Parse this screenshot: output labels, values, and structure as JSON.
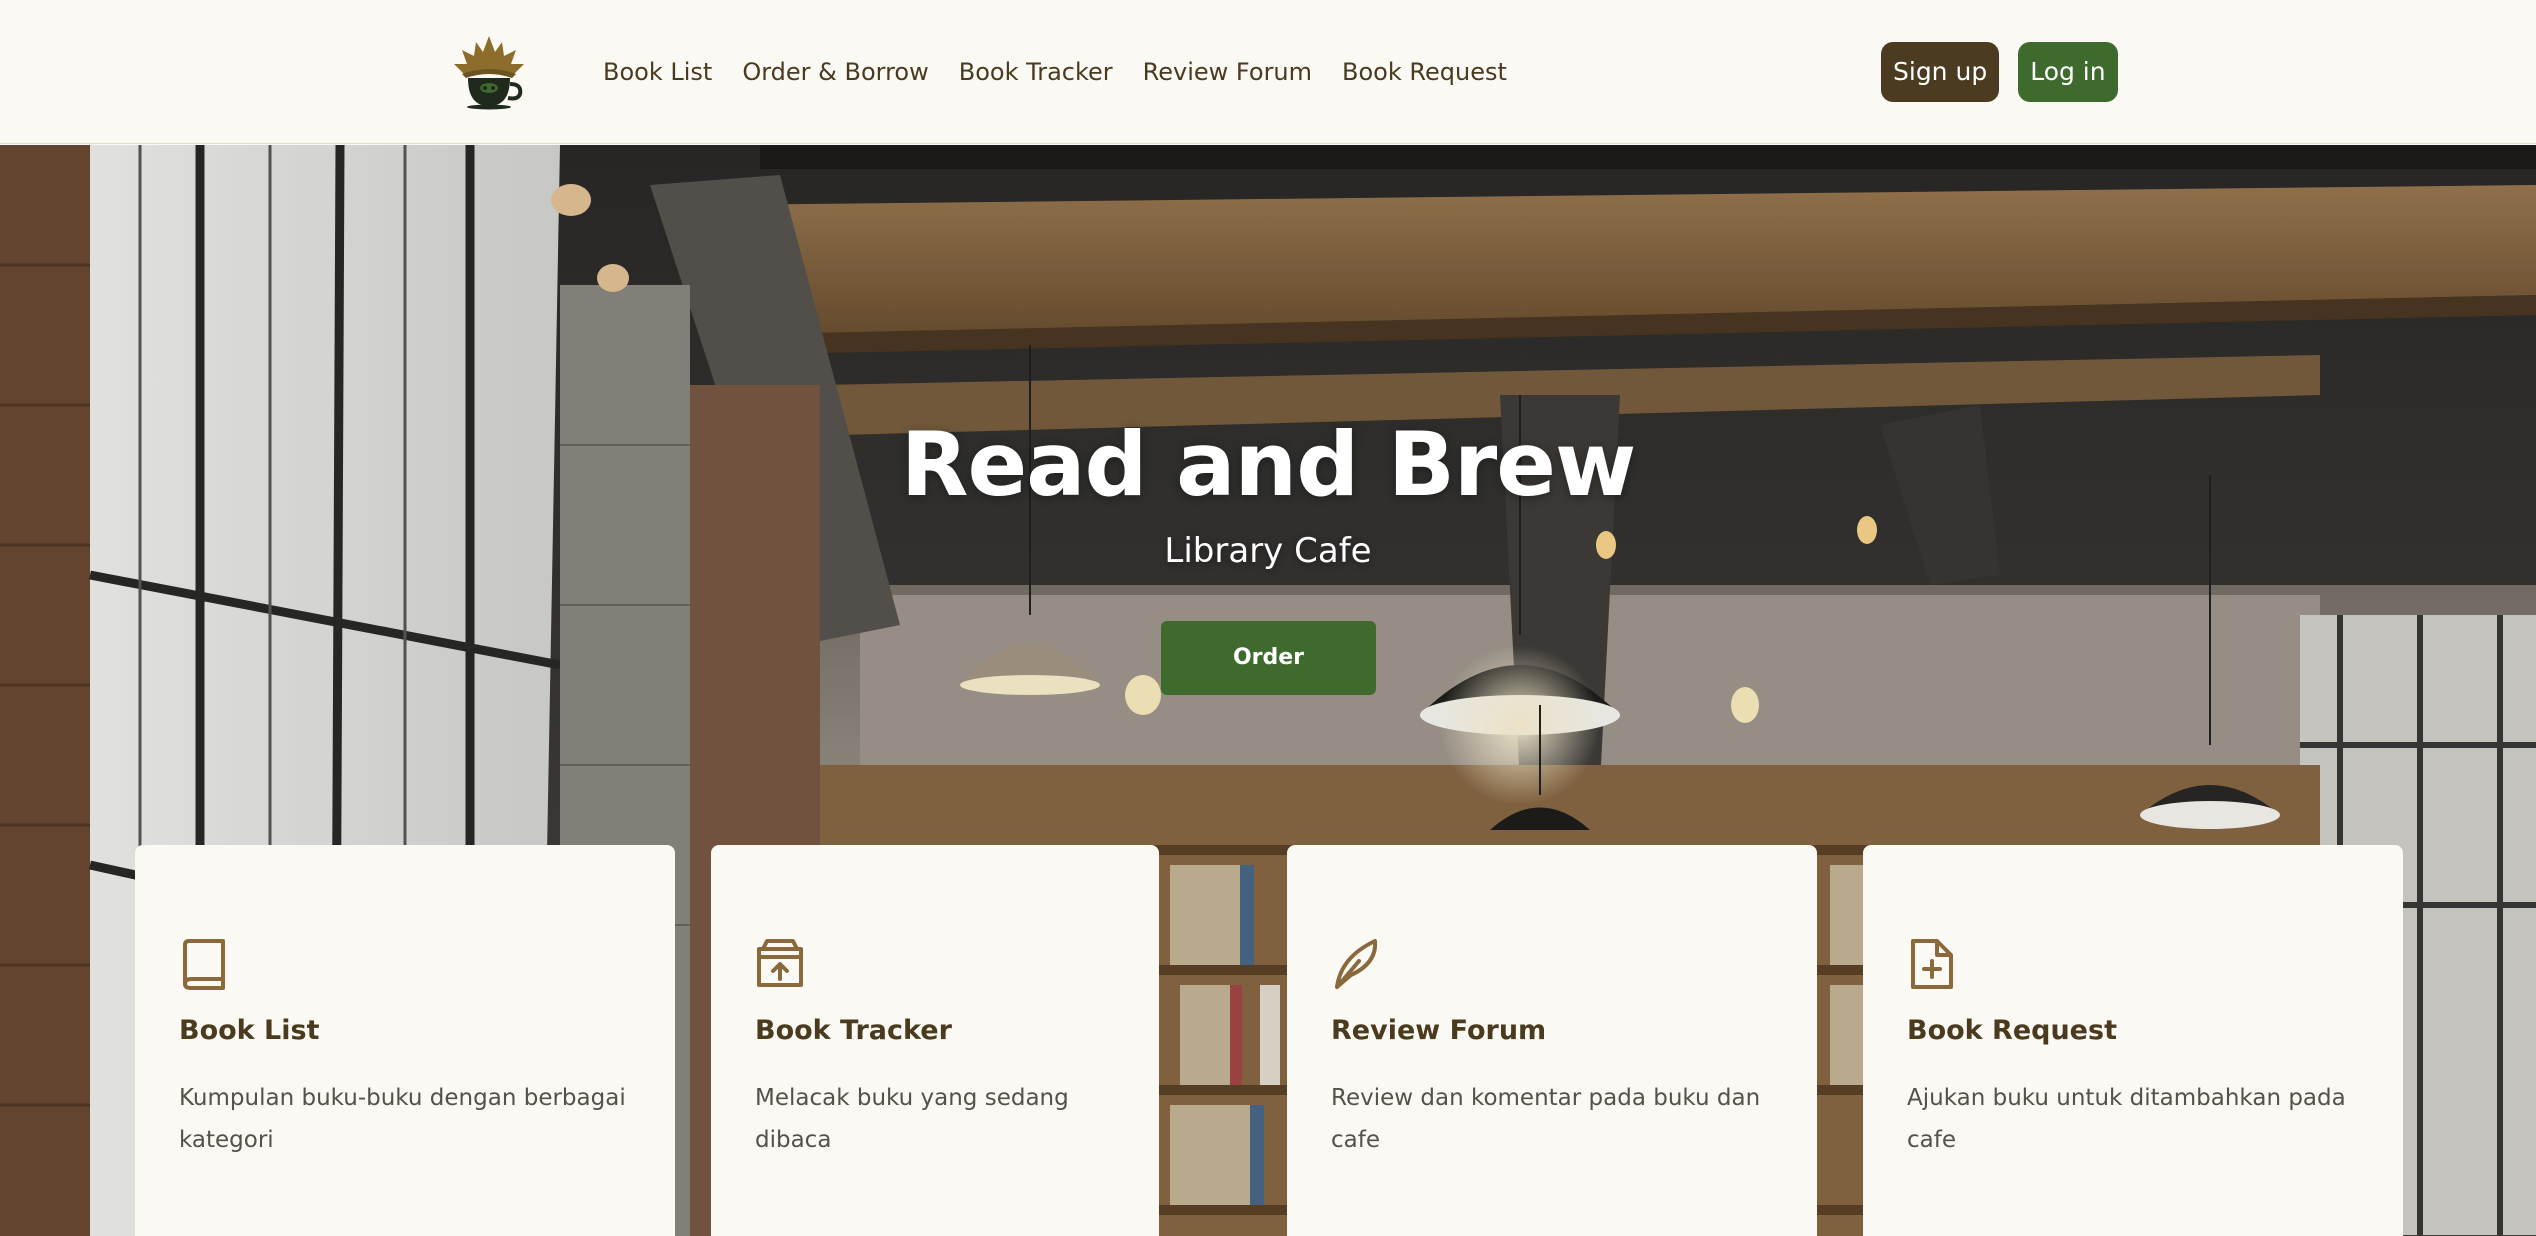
{
  "nav": {
    "logo_icon": "book-coffee-cup-logo",
    "links": [
      "Book List",
      "Order & Borrow",
      "Book Tracker",
      "Review Forum",
      "Book Request"
    ],
    "signup_label": "Sign up",
    "login_label": "Log in"
  },
  "hero": {
    "title": "Read and Brew",
    "subtitle": "Library Cafe",
    "order_label": "Order"
  },
  "cards": [
    {
      "icon": "book-icon",
      "title": "Book List",
      "description": "Kumpulan buku-buku dengan berbagai kategori"
    },
    {
      "icon": "archive-upload-icon",
      "title": "Book Tracker",
      "description": "Melacak buku yang sedang dibaca"
    },
    {
      "icon": "feather-icon",
      "title": "Review Forum",
      "description": "Review dan komentar pada buku dan cafe"
    },
    {
      "icon": "file-plus-icon",
      "title": "Book Request",
      "description": "Ajukan buku untuk ditambahkan pada cafe"
    }
  ],
  "colors": {
    "background": "#fbf9f4",
    "brand_brown": "#4b3c21",
    "brand_green": "#3e6a2e",
    "icon_brown": "#8a6a3c"
  }
}
